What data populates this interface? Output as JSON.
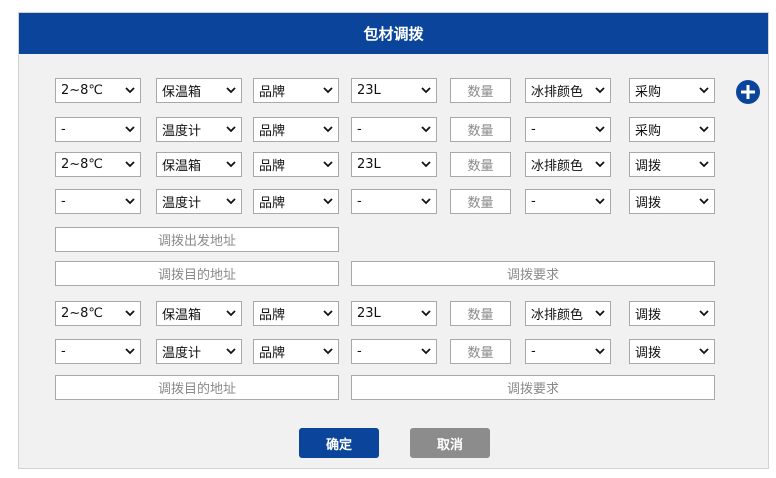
{
  "dialog": {
    "title": "包材调拨",
    "confirm_label": "确定",
    "cancel_label": "取消",
    "add_icon": "plus-circle-icon",
    "accent_color": "#0a459b"
  },
  "rows": [
    [
      "2~8℃",
      "保温箱",
      "品牌",
      "23L",
      "数量",
      "冰排颜色",
      "采购"
    ],
    [
      "-",
      "温度计",
      "品牌",
      "-",
      "数量",
      "-",
      "采购"
    ],
    [
      "2~8℃",
      "保温箱",
      "品牌",
      "23L",
      "数量",
      "冰排颜色",
      "调拨"
    ],
    [
      "-",
      "温度计",
      "品牌",
      "-",
      "数量",
      "-",
      "调拨"
    ],
    [
      "2~8℃",
      "保温箱",
      "品牌",
      "23L",
      "数量",
      "冰排颜色",
      "调拨"
    ],
    [
      "-",
      "温度计",
      "品牌",
      "-",
      "数量",
      "-",
      "调拨"
    ]
  ],
  "address_fields": {
    "origin_placeholder": "调拨出发地址",
    "destination_placeholder_1": "调拨目的地址",
    "requirement_placeholder_1": "调拨要求",
    "destination_placeholder_2": "调拨目的地址",
    "requirement_placeholder_2": "调拨要求"
  }
}
